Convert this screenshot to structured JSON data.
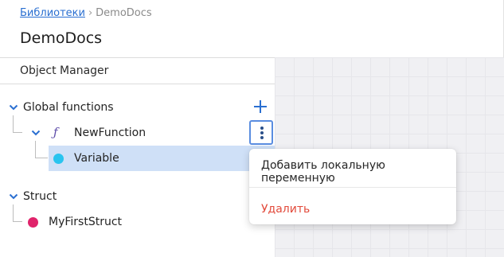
{
  "breadcrumb": {
    "root": "Библиотеки",
    "separator": "›",
    "current": "DemoDocs"
  },
  "page": {
    "title": "DemoDocs"
  },
  "panel": {
    "title": "Object Manager"
  },
  "tree": {
    "global_functions": {
      "label": "Global functions",
      "add_icon": "plus-icon",
      "function": {
        "icon": "function-icon",
        "icon_glyph": "ƒ",
        "label": "NewFunction",
        "more_icon": "kebab-menu-icon",
        "variable": {
          "label": "Variable",
          "dot_color": "#29c4ef"
        }
      }
    },
    "struct": {
      "label": "Struct",
      "child": {
        "label": "MyFirstStruct",
        "dot_color": "#e0236b"
      }
    }
  },
  "context_menu": {
    "add_local_variable": "Добавить локальную переменную",
    "delete": "Удалить"
  },
  "colors": {
    "accent": "#2a6fd1",
    "selected_bg": "#cfe0f7",
    "danger": "#e24a3b"
  }
}
